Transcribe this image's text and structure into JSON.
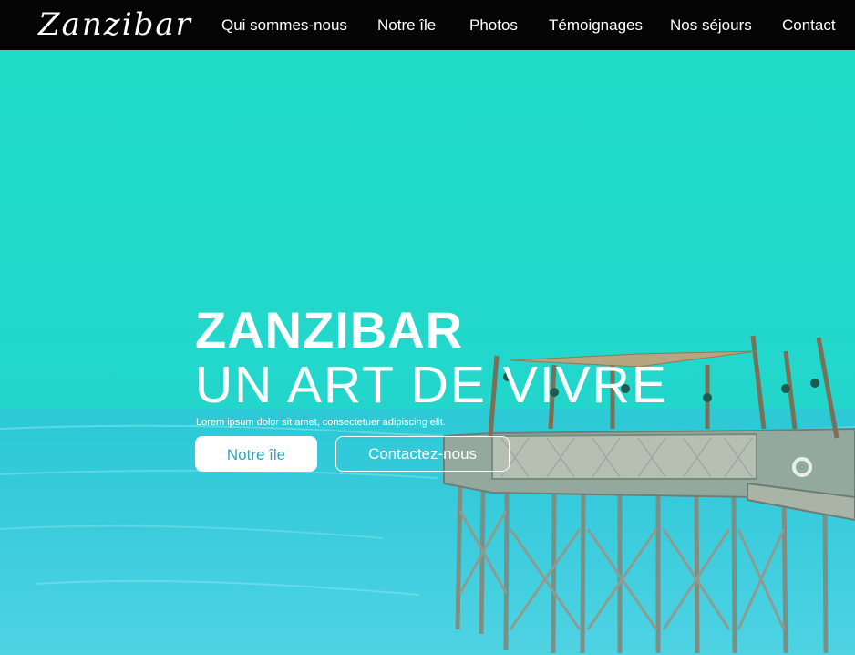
{
  "nav": {
    "logo": "Zanzibar",
    "links": [
      "Qui sommes-nous",
      "Notre île",
      "Photos",
      "Témoignages",
      "Nos séjours",
      "Contact"
    ]
  },
  "hero": {
    "title": "ZANZIBAR",
    "subtitle": "UN ART DE VIVRE",
    "tagline": "Lorem ipsum dolor sit amet, consectetuer adipiscing elit.",
    "primary_button": "Notre île",
    "secondary_button": "Contactez-nous"
  },
  "colors": {
    "navbar": "#050505",
    "sky": "#1fd6c8",
    "sea": "#21c8d2",
    "text": "#ffffff",
    "primary_button_text": "#2aa6bd"
  }
}
